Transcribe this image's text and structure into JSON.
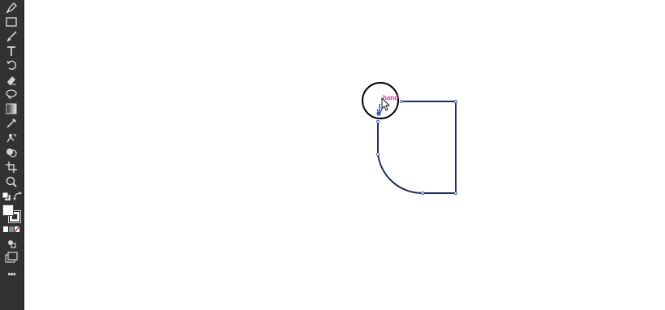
{
  "toolbar": {
    "tools": [
      {
        "icon": "pen-tool-icon"
      },
      {
        "icon": "rectangle-tool-icon"
      },
      {
        "icon": "paintbrush-tool-icon"
      },
      {
        "icon": "type-tool-icon"
      },
      {
        "icon": "rotate-tool-icon"
      },
      {
        "icon": "eraser-tool-icon"
      },
      {
        "icon": "lasso-tool-icon"
      },
      {
        "icon": "gradient-tool-icon"
      },
      {
        "icon": "eyedropper-tool-icon"
      },
      {
        "icon": "puppet-warp-tool-icon"
      },
      {
        "icon": "shape-builder-tool-icon"
      },
      {
        "icon": "artboard-tool-icon"
      },
      {
        "icon": "zoom-tool-icon"
      }
    ],
    "more_label": "•••"
  },
  "canvas": {
    "smart_guide_label": "hand",
    "colors": {
      "path_stroke": "#1f2f66",
      "anchor": "#2d5bd8",
      "guide_label": "#cc3399",
      "highlight_circle": "#000000"
    }
  }
}
